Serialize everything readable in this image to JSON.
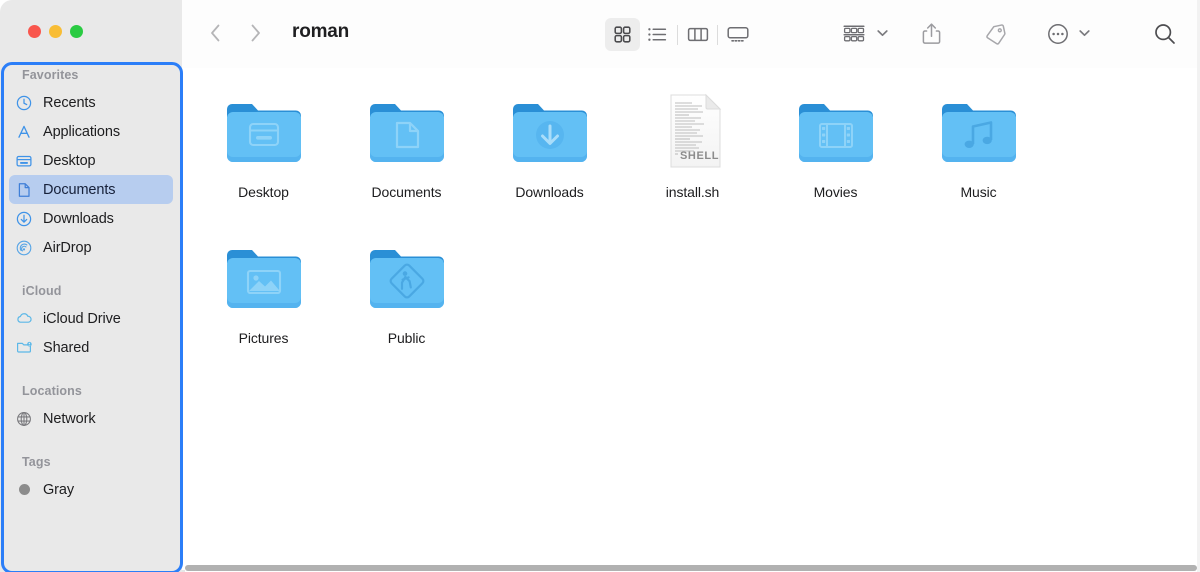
{
  "window": {
    "title": "roman",
    "traffic_lights": [
      {
        "name": "close",
        "color": "#f9564d"
      },
      {
        "name": "minimize",
        "color": "#f8bd35"
      },
      {
        "name": "zoom",
        "color": "#2acb42"
      }
    ]
  },
  "toolbar": {
    "back_label": "Back",
    "forward_label": "Forward",
    "view_modes": [
      {
        "id": "icon",
        "label": "Icon View",
        "icon": "grid-icon",
        "active": true
      },
      {
        "id": "list",
        "label": "List View",
        "icon": "list-icon",
        "active": false
      },
      {
        "id": "column",
        "label": "Column View",
        "icon": "columns-icon",
        "active": false
      },
      {
        "id": "gallery",
        "label": "Gallery View",
        "icon": "gallery-icon",
        "active": false
      }
    ],
    "actions": [
      {
        "id": "group",
        "label": "Group items",
        "icon": "group-by-icon",
        "has_chevron": true
      },
      {
        "id": "share",
        "label": "Share",
        "icon": "share-icon",
        "has_chevron": false
      },
      {
        "id": "tags",
        "label": "Edit Tags",
        "icon": "tag-icon",
        "has_chevron": false
      },
      {
        "id": "more",
        "label": "More",
        "icon": "ellipsis-circle-icon",
        "has_chevron": true
      }
    ],
    "search_label": "Search"
  },
  "sidebar": {
    "accent_color": "#2b7ef8",
    "selection_color": "#b7cdef",
    "sections": [
      {
        "title": "Favorites",
        "items": [
          {
            "label": "Recents",
            "icon": "clock-icon",
            "selected": false
          },
          {
            "label": "Applications",
            "icon": "applications-icon",
            "selected": false
          },
          {
            "label": "Desktop",
            "icon": "desktop-icon",
            "selected": false
          },
          {
            "label": "Documents",
            "icon": "document-icon",
            "selected": true
          },
          {
            "label": "Downloads",
            "icon": "download-circle-icon",
            "selected": false
          },
          {
            "label": "AirDrop",
            "icon": "airdrop-icon",
            "selected": false
          }
        ]
      },
      {
        "title": "iCloud",
        "items": [
          {
            "label": "iCloud Drive",
            "icon": "cloud-icon",
            "selected": false
          },
          {
            "label": "Shared",
            "icon": "shared-folder-icon",
            "selected": false
          }
        ]
      },
      {
        "title": "Locations",
        "items": [
          {
            "label": "Network",
            "icon": "globe-icon",
            "selected": false
          }
        ]
      },
      {
        "title": "Tags",
        "items": [
          {
            "label": "Gray",
            "icon": "gray-tag-dot",
            "color": "#8c8c8c",
            "selected": false
          }
        ]
      }
    ]
  },
  "content": {
    "items": [
      {
        "name": "Desktop",
        "kind": "folder",
        "glyph": "desktop-window-glyph"
      },
      {
        "name": "Documents",
        "kind": "folder",
        "glyph": "document-page-glyph"
      },
      {
        "name": "Downloads",
        "kind": "folder",
        "glyph": "download-arrow-glyph"
      },
      {
        "name": "install.sh",
        "kind": "file",
        "glyph": "shell-script-glyph",
        "badge": "SHELL"
      },
      {
        "name": "Movies",
        "kind": "folder",
        "glyph": "film-strip-glyph"
      },
      {
        "name": "Music",
        "kind": "folder",
        "glyph": "music-note-glyph"
      },
      {
        "name": "Pictures",
        "kind": "folder",
        "glyph": "photo-glyph"
      },
      {
        "name": "Public",
        "kind": "folder",
        "glyph": "crossing-sign-glyph"
      }
    ]
  }
}
